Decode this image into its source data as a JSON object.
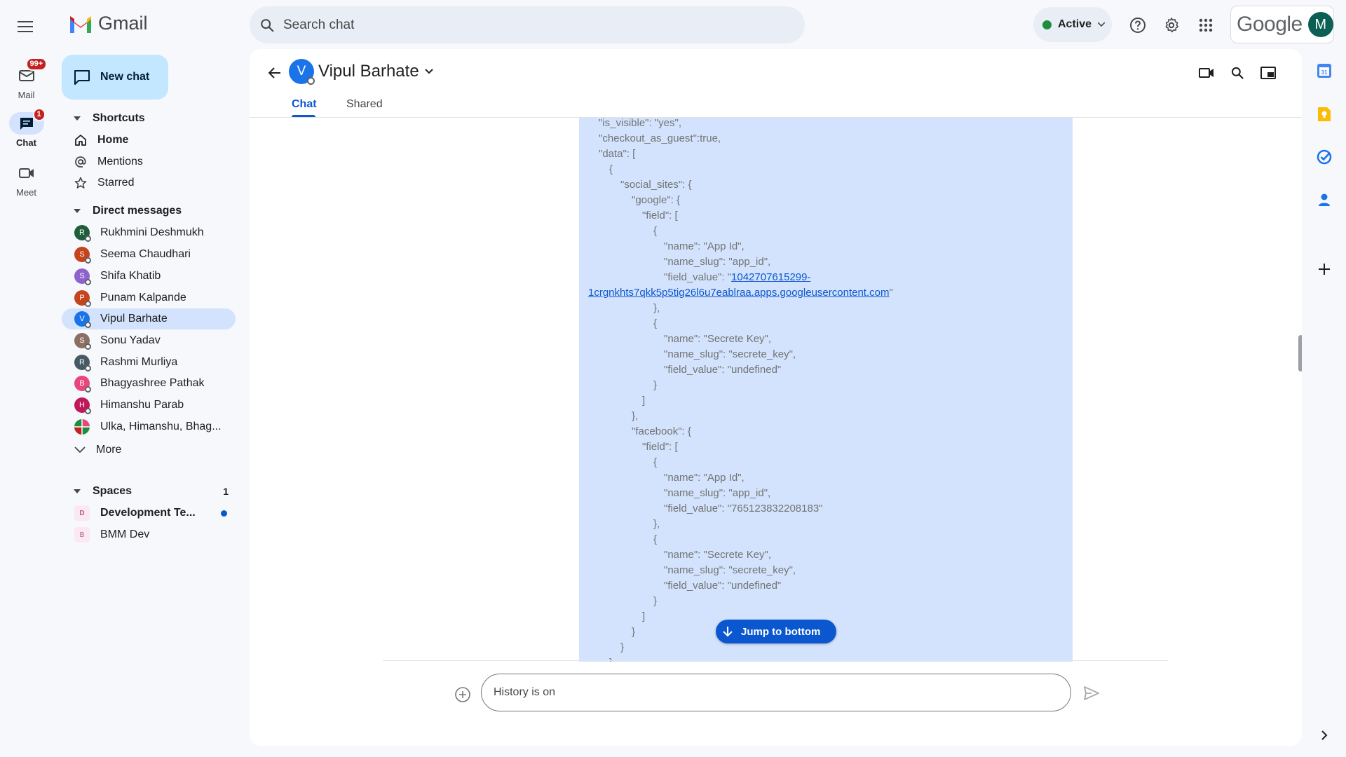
{
  "app": {
    "name": "Gmail"
  },
  "search": {
    "placeholder": "Search chat"
  },
  "status": {
    "label": "Active"
  },
  "brand": {
    "google_word": "Google",
    "account_initial": "M"
  },
  "rail": {
    "mail": {
      "label": "Mail",
      "badge": "99+"
    },
    "chat": {
      "label": "Chat",
      "badge": "1"
    },
    "meet": {
      "label": "Meet"
    }
  },
  "sidebar": {
    "new_chat": "New chat",
    "shortcuts": {
      "heading": "Shortcuts",
      "items": [
        {
          "label": "Home"
        },
        {
          "label": "Mentions"
        },
        {
          "label": "Starred"
        }
      ]
    },
    "direct_messages": {
      "heading": "Direct messages",
      "items": [
        {
          "label": "Rukhmini Deshmukh",
          "initial": "R",
          "color": "#1e5e3b"
        },
        {
          "label": "Seema Chaudhari",
          "initial": "S",
          "color": "#c5441d"
        },
        {
          "label": "Shifa Khatib",
          "initial": "S",
          "color": "#8e63ce"
        },
        {
          "label": "Punam Kalpande",
          "initial": "P",
          "color": "#c5441d"
        },
        {
          "label": "Vipul Barhate",
          "initial": "V",
          "color": "#1a73e8"
        },
        {
          "label": "Sonu Yadav",
          "initial": "S",
          "color": "#8d6e63"
        },
        {
          "label": "Rashmi Murliya",
          "initial": "R",
          "color": "#455a64"
        },
        {
          "label": "Bhagyashree Pathak",
          "initial": "B",
          "color": "#e8467c"
        },
        {
          "label": "Himanshu Parab",
          "initial": "H",
          "color": "#c2185b"
        },
        {
          "label": "Ulka, Himanshu, Bhag..."
        }
      ],
      "more": "More"
    },
    "spaces": {
      "heading": "Spaces",
      "count": "1",
      "items": [
        {
          "label": "Development Te...",
          "initial": "D"
        },
        {
          "label": "BMM Dev",
          "initial": "B"
        }
      ]
    }
  },
  "conversation": {
    "title": "Vipul Barhate",
    "initial": "V",
    "tabs": {
      "chat": "Chat",
      "shared": "Shared"
    },
    "jump_to_bottom": "Jump to bottom",
    "compose_placeholder": "History is on",
    "message_lines": [
      "\"is_visible\": \"yes\",",
      "\"checkout_as_guest\":true,",
      "\"data\": [",
      "{",
      "\"social_sites\": {",
      "\"google\": {",
      "\"field\": [",
      "{",
      "\"name\": \"App Id\",",
      "\"name_slug\": \"app_id\",",
      "\"field_value\": \"",
      "1042707615299-",
      "1crgnkhts7qkk5p5tig26l6u7eablraa.apps.googleusercontent.com",
      "\"",
      "},",
      "{",
      "\"name\": \"Secrete Key\",",
      "\"name_slug\": \"secrete_key\",",
      "\"field_value\": \"undefined\"",
      "}",
      "]",
      "},",
      "\"facebook\": {",
      "\"field\": [",
      "{",
      "\"name\": \"App Id\",",
      "\"name_slug\": \"app_id\",",
      "\"field_value\": \"765123832208183\"",
      "},",
      "{",
      "\"name\": \"Secrete Key\",",
      "\"name_slug\": \"secrete_key\",",
      "\"field_value\": \"undefined\"",
      "}",
      "]",
      "}",
      "}",
      "}"
    ]
  },
  "colors": {
    "accent": "#0b57d0",
    "selected": "#d3e3fd",
    "background": "#f6f8fc",
    "new_chat": "#c2e7ff"
  }
}
